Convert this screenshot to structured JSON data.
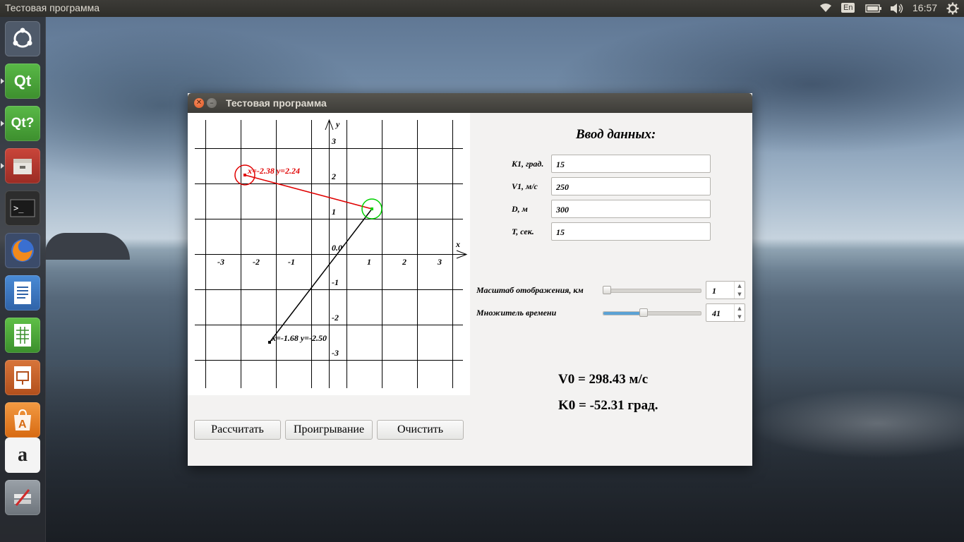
{
  "top_panel": {
    "app_title": "Тестовая программа",
    "keyboard_layout": "En",
    "clock": "16:57"
  },
  "launcher": {
    "items": [
      {
        "name": "ubuntu-dash",
        "glyph": "◎"
      },
      {
        "name": "qt-creator",
        "glyph": "Qt"
      },
      {
        "name": "qt-assistant",
        "glyph": "Qt?"
      },
      {
        "name": "file-manager",
        "glyph": "▭"
      },
      {
        "name": "terminal",
        "glyph": ">_"
      },
      {
        "name": "firefox",
        "glyph": "●"
      },
      {
        "name": "libreoffice-writer",
        "glyph": "≡"
      },
      {
        "name": "libreoffice-calc",
        "glyph": "▦"
      },
      {
        "name": "libreoffice-impress",
        "glyph": "▣"
      },
      {
        "name": "software-center",
        "glyph": "A"
      },
      {
        "name": "amazon",
        "glyph": "a"
      },
      {
        "name": "system-settings",
        "glyph": "✎"
      }
    ]
  },
  "window": {
    "title": "Тестовая программа"
  },
  "plot": {
    "x_axis_label": "x",
    "y_axis_label": "y",
    "origin_label": "0.0",
    "x_ticks": [
      "-3",
      "-2",
      "-1",
      "1",
      "2",
      "3"
    ],
    "y_ticks": [
      "3",
      "2",
      "1",
      "-1",
      "-2",
      "-3"
    ],
    "target": {
      "x": -2.38,
      "y": 2.24,
      "label": "x=-2.38 y=2.24",
      "color": "#e00000"
    },
    "interceptor": {
      "x": 1.22,
      "y": 1.28,
      "color": "#00d000"
    },
    "start": {
      "x": -1.68,
      "y": -2.5,
      "label": "x=-1.68 y=-2.50",
      "color": "#000000"
    }
  },
  "buttons": {
    "calculate": "Рассчитать",
    "playback": "Проигрывание",
    "clear": "Очистить"
  },
  "form": {
    "title": "Ввод данных:",
    "k1_label": "K1, град.",
    "k1_value": "15",
    "v1_label": "V1, м/с",
    "v1_value": "250",
    "d_label": "D, м",
    "d_value": "300",
    "t_label": "T, сек.",
    "t_value": "15"
  },
  "sliders": {
    "scale_label": "Масштаб отображения, км",
    "scale_value": "1",
    "scale_fraction": 0.0,
    "time_label": "Множитель времени",
    "time_value": "41",
    "time_fraction": 0.41
  },
  "results": {
    "v0": "V0 = 298.43 м/с",
    "k0": "K0 = -52.31 град."
  },
  "colors": {
    "accent": "#5aa2d5",
    "target_red": "#e00000",
    "interceptor_green": "#00d000"
  }
}
